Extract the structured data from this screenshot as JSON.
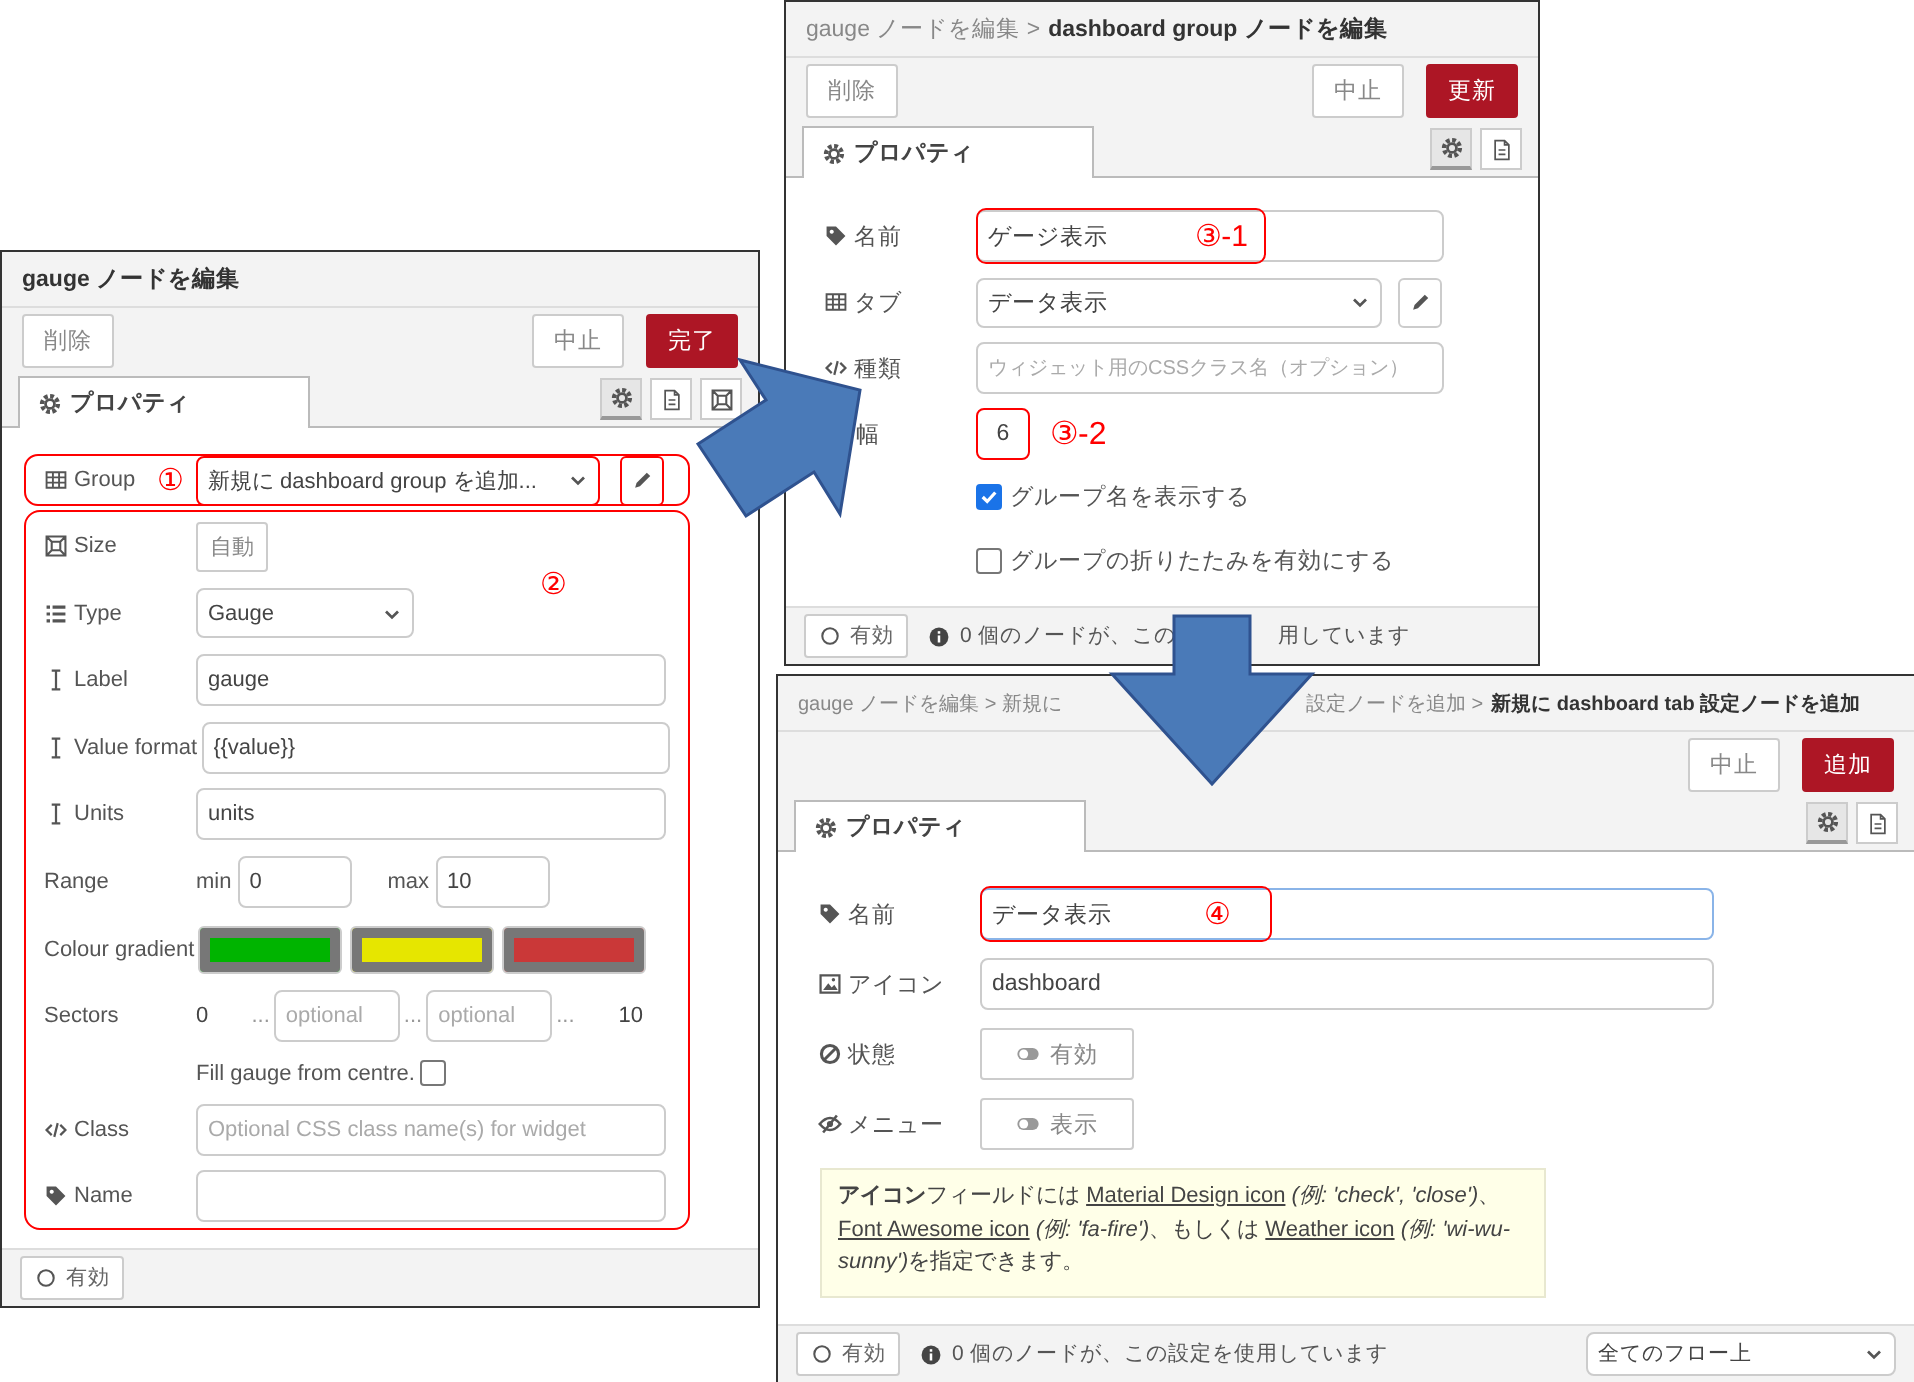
{
  "gauge_editor": {
    "title": "gauge ノードを編集",
    "buttons": {
      "delete": "削除",
      "cancel": "中止",
      "done": "完了"
    },
    "tab": {
      "label": "プロパティ",
      "selected": true
    },
    "side_tabs": [
      {
        "selected": true
      },
      {
        "selected": false
      },
      {
        "selected": false
      }
    ],
    "group": {
      "label": "Group",
      "callout": "①",
      "value": "新規に dashboard group を追加..."
    },
    "settings_callout": "②",
    "size": {
      "label": "Size",
      "value": "自動"
    },
    "type": {
      "label": "Type",
      "value": "Gauge"
    },
    "label": {
      "label": "Label",
      "value": "gauge"
    },
    "value_format": {
      "label": "Value format",
      "value": "{{value}}"
    },
    "units": {
      "label": "Units",
      "value": "units"
    },
    "range": {
      "label": "Range",
      "min_label": "min",
      "min": "0",
      "max_label": "max",
      "max": "10"
    },
    "colour_gradient": {
      "label": "Colour gradient",
      "stops": [
        {
          "color": "#00b400"
        },
        {
          "color": "#e6e600"
        },
        {
          "color": "#ca3838"
        }
      ]
    },
    "sectors": {
      "label": "Sectors",
      "start": "0",
      "separators": [
        "...",
        "...",
        "..."
      ],
      "placeholders": [
        "optional",
        "optional"
      ],
      "end": "10"
    },
    "fill_from_centre": {
      "label": "Fill gauge from centre.",
      "checked": false
    },
    "class": {
      "label": "Class",
      "placeholder": "Optional CSS class name(s) for widget"
    },
    "name": {
      "label": "Name"
    },
    "enabled_button": "有効"
  },
  "group_editor": {
    "breadcrumb": "gauge ノードを編集 >",
    "title": "dashboard group ノードを編集",
    "buttons": {
      "delete": "削除",
      "cancel": "中止",
      "update": "更新"
    },
    "tab": {
      "label": "プロパティ",
      "selected": true
    },
    "side_tabs": [
      {
        "selected": true
      },
      {
        "selected": false
      }
    ],
    "name": {
      "label": "名前",
      "value": "ゲージ表示",
      "callout": "③-1"
    },
    "tab_field": {
      "label": "タブ",
      "value": "データ表示"
    },
    "class": {
      "label": "種類",
      "placeholder": "ウィジェット用のCSSクラス名（オプション）"
    },
    "width": {
      "label": "幅",
      "value": "6",
      "callout": "③-2"
    },
    "options": [
      {
        "label": "グループ名を表示する",
        "checked": true
      },
      {
        "label": "グループの折りたたみを有効にする",
        "checked": false
      }
    ],
    "enabled_button": "有効",
    "usage": [
      "0 個のノードが、この",
      "用しています"
    ]
  },
  "tab_editor": {
    "breadcrumb": [
      "gauge ノードを編集 > 新規に",
      "設定ノードを追加 >"
    ],
    "title": "新規に dashboard tab 設定ノードを追加",
    "buttons": {
      "cancel": "中止",
      "add": "追加"
    },
    "tab": {
      "label": "プロパティ",
      "selected": true
    },
    "side_tabs": [
      {
        "selected": true
      },
      {
        "selected": false
      }
    ],
    "name": {
      "label": "名前",
      "value": "データ表示",
      "callout": "④",
      "focused": true
    },
    "icon": {
      "label": "アイコン",
      "value": "dashboard"
    },
    "state": {
      "label": "状態",
      "value": "有効"
    },
    "menu": {
      "label": "メニュー",
      "value": "表示"
    },
    "help": [
      {
        "kind": "text",
        "text": "**アイコン**フィールドには "
      },
      {
        "kind": "link",
        "text": "Material Design icon"
      },
      {
        "kind": "note",
        "text": " (例: 'check', 'close')"
      },
      {
        "kind": "text",
        "text": "、"
      },
      {
        "kind": "link",
        "text": "Font Awesome icon"
      },
      {
        "kind": "note",
        "text": " (例: 'fa-fire')"
      },
      {
        "kind": "text",
        "text": "、もしくは "
      },
      {
        "kind": "link",
        "text": "Weather icon"
      },
      {
        "kind": "note",
        "text": " (例: 'wi-wu-sunny')"
      },
      {
        "kind": "text",
        "text": "を指定できます。"
      }
    ],
    "enabled_button": "有効",
    "usage": "0 個のノードが、この設定を使用しています",
    "scope": "全てのフロー上"
  }
}
